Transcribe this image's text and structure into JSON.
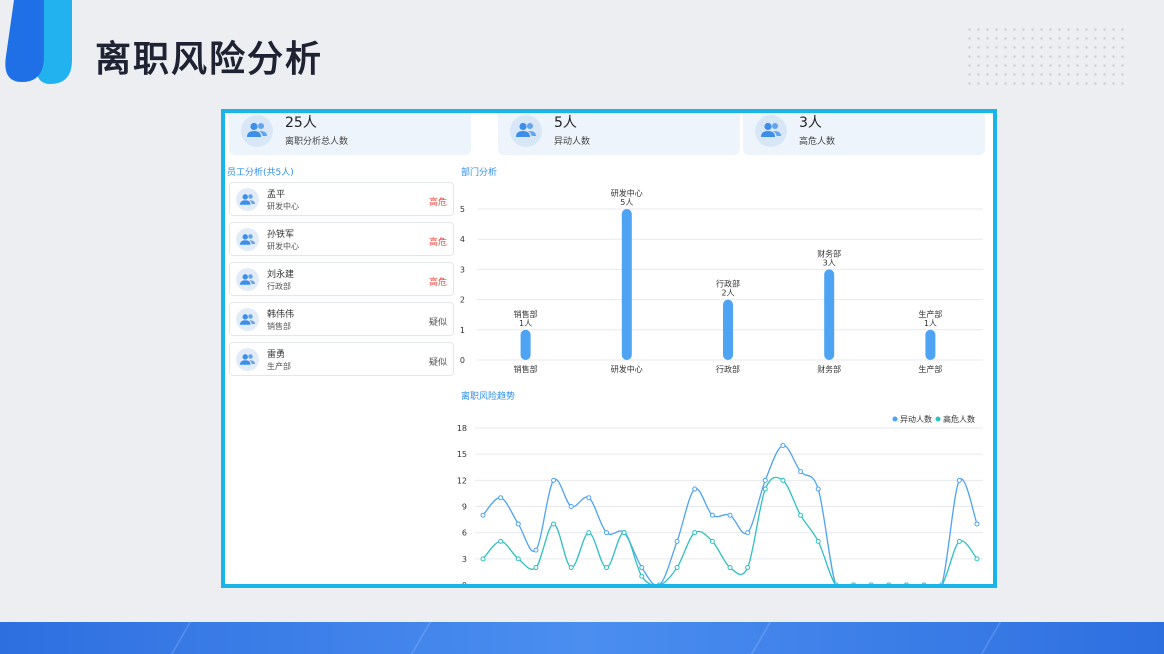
{
  "page": {
    "title": "离职风险分析"
  },
  "stats": [
    {
      "value": "25人",
      "label": "离职分析总人数",
      "icon": "users-icon"
    },
    {
      "value": "5人",
      "label": "异动人数",
      "icon": "users-icon"
    },
    {
      "value": "3人",
      "label": "高危人数",
      "icon": "users-icon"
    }
  ],
  "employees": {
    "title": "员工分析(共5人)",
    "items": [
      {
        "name": "孟平",
        "dept": "研发中心",
        "status": "高危",
        "status_color": "#e8473f"
      },
      {
        "name": "孙铁军",
        "dept": "研发中心",
        "status": "高危",
        "status_color": "#e8473f"
      },
      {
        "name": "刘永建",
        "dept": "行政部",
        "status": "高危",
        "status_color": "#e8473f"
      },
      {
        "name": "韩伟伟",
        "dept": "销售部",
        "status": "疑似",
        "status_color": "#555555"
      },
      {
        "name": "雷勇",
        "dept": "生产部",
        "status": "疑似",
        "status_color": "#555555"
      }
    ]
  },
  "colors": {
    "accent": "#2d8ff0",
    "frame": "#19b5e9",
    "bar": "#4ea3f2",
    "line1": "#4ea3f2",
    "line2": "#2ec0c2"
  },
  "chart_data": [
    {
      "type": "bar",
      "title": "部门分析",
      "categories": [
        "销售部",
        "研发中心",
        "行政部",
        "财务部",
        "生产部"
      ],
      "values": [
        1,
        5,
        2,
        3,
        1
      ],
      "data_labels": [
        "1人",
        "5人",
        "2人",
        "3人",
        "1人"
      ],
      "ylim": [
        0,
        5
      ],
      "yticks": [
        0,
        1,
        2,
        3,
        4,
        5
      ],
      "grid": true
    },
    {
      "type": "line",
      "title": "离职风险趋势",
      "legend_position": "top-right",
      "ylim": [
        0,
        18
      ],
      "yticks": [
        0,
        3,
        6,
        9,
        12,
        15,
        18
      ],
      "series": [
        {
          "name": "异动人数",
          "color": "#4ea3f2",
          "values": [
            8,
            10,
            7,
            4,
            12,
            9,
            10,
            6,
            6,
            2,
            0,
            5,
            11,
            8,
            8,
            6,
            12,
            16,
            13,
            11,
            0,
            0,
            0,
            0,
            0,
            0,
            0,
            12,
            7
          ]
        },
        {
          "name": "高危人数",
          "color": "#2ec0c2",
          "values": [
            3,
            5,
            3,
            2,
            7,
            2,
            6,
            2,
            6,
            1,
            0,
            2,
            6,
            5,
            2,
            2,
            11,
            12,
            8,
            5,
            0,
            0,
            0,
            0,
            0,
            0,
            0,
            5,
            3
          ]
        }
      ],
      "grid": true
    }
  ]
}
